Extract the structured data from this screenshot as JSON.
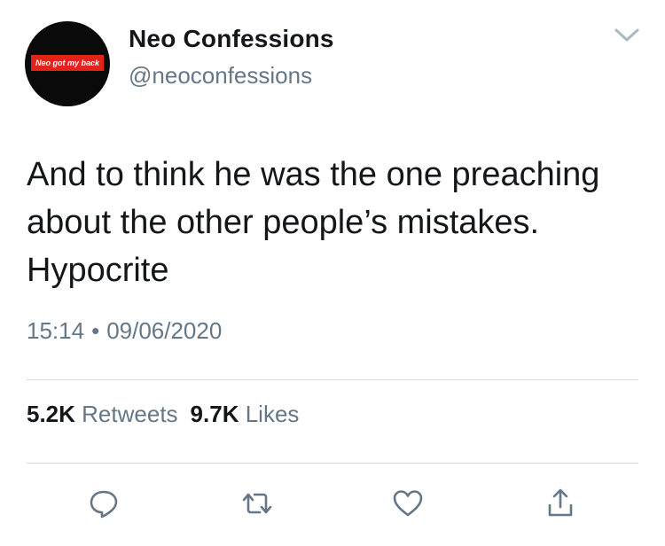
{
  "author": {
    "display_name": "Neo Confessions",
    "handle": "@neoconfessions",
    "avatar_text": "Neo got my back"
  },
  "tweet": {
    "text": "And to think he was the one preaching about the other people’s mistakes. Hypocrite",
    "time": "15:14",
    "separator": "•",
    "date": "09/06/2020"
  },
  "stats": {
    "retweets_count": "5.2K",
    "retweets_label": "Retweets",
    "likes_count": "9.7K",
    "likes_label": "Likes"
  },
  "icons": {
    "menu": "chevron-down-icon",
    "reply": "reply-icon",
    "retweet": "retweet-icon",
    "like": "heart-icon",
    "share": "share-icon"
  },
  "colors": {
    "text": "#14171a",
    "secondary": "#657786",
    "divider": "#d8dde1",
    "avatar_badge": "#e2231a"
  }
}
